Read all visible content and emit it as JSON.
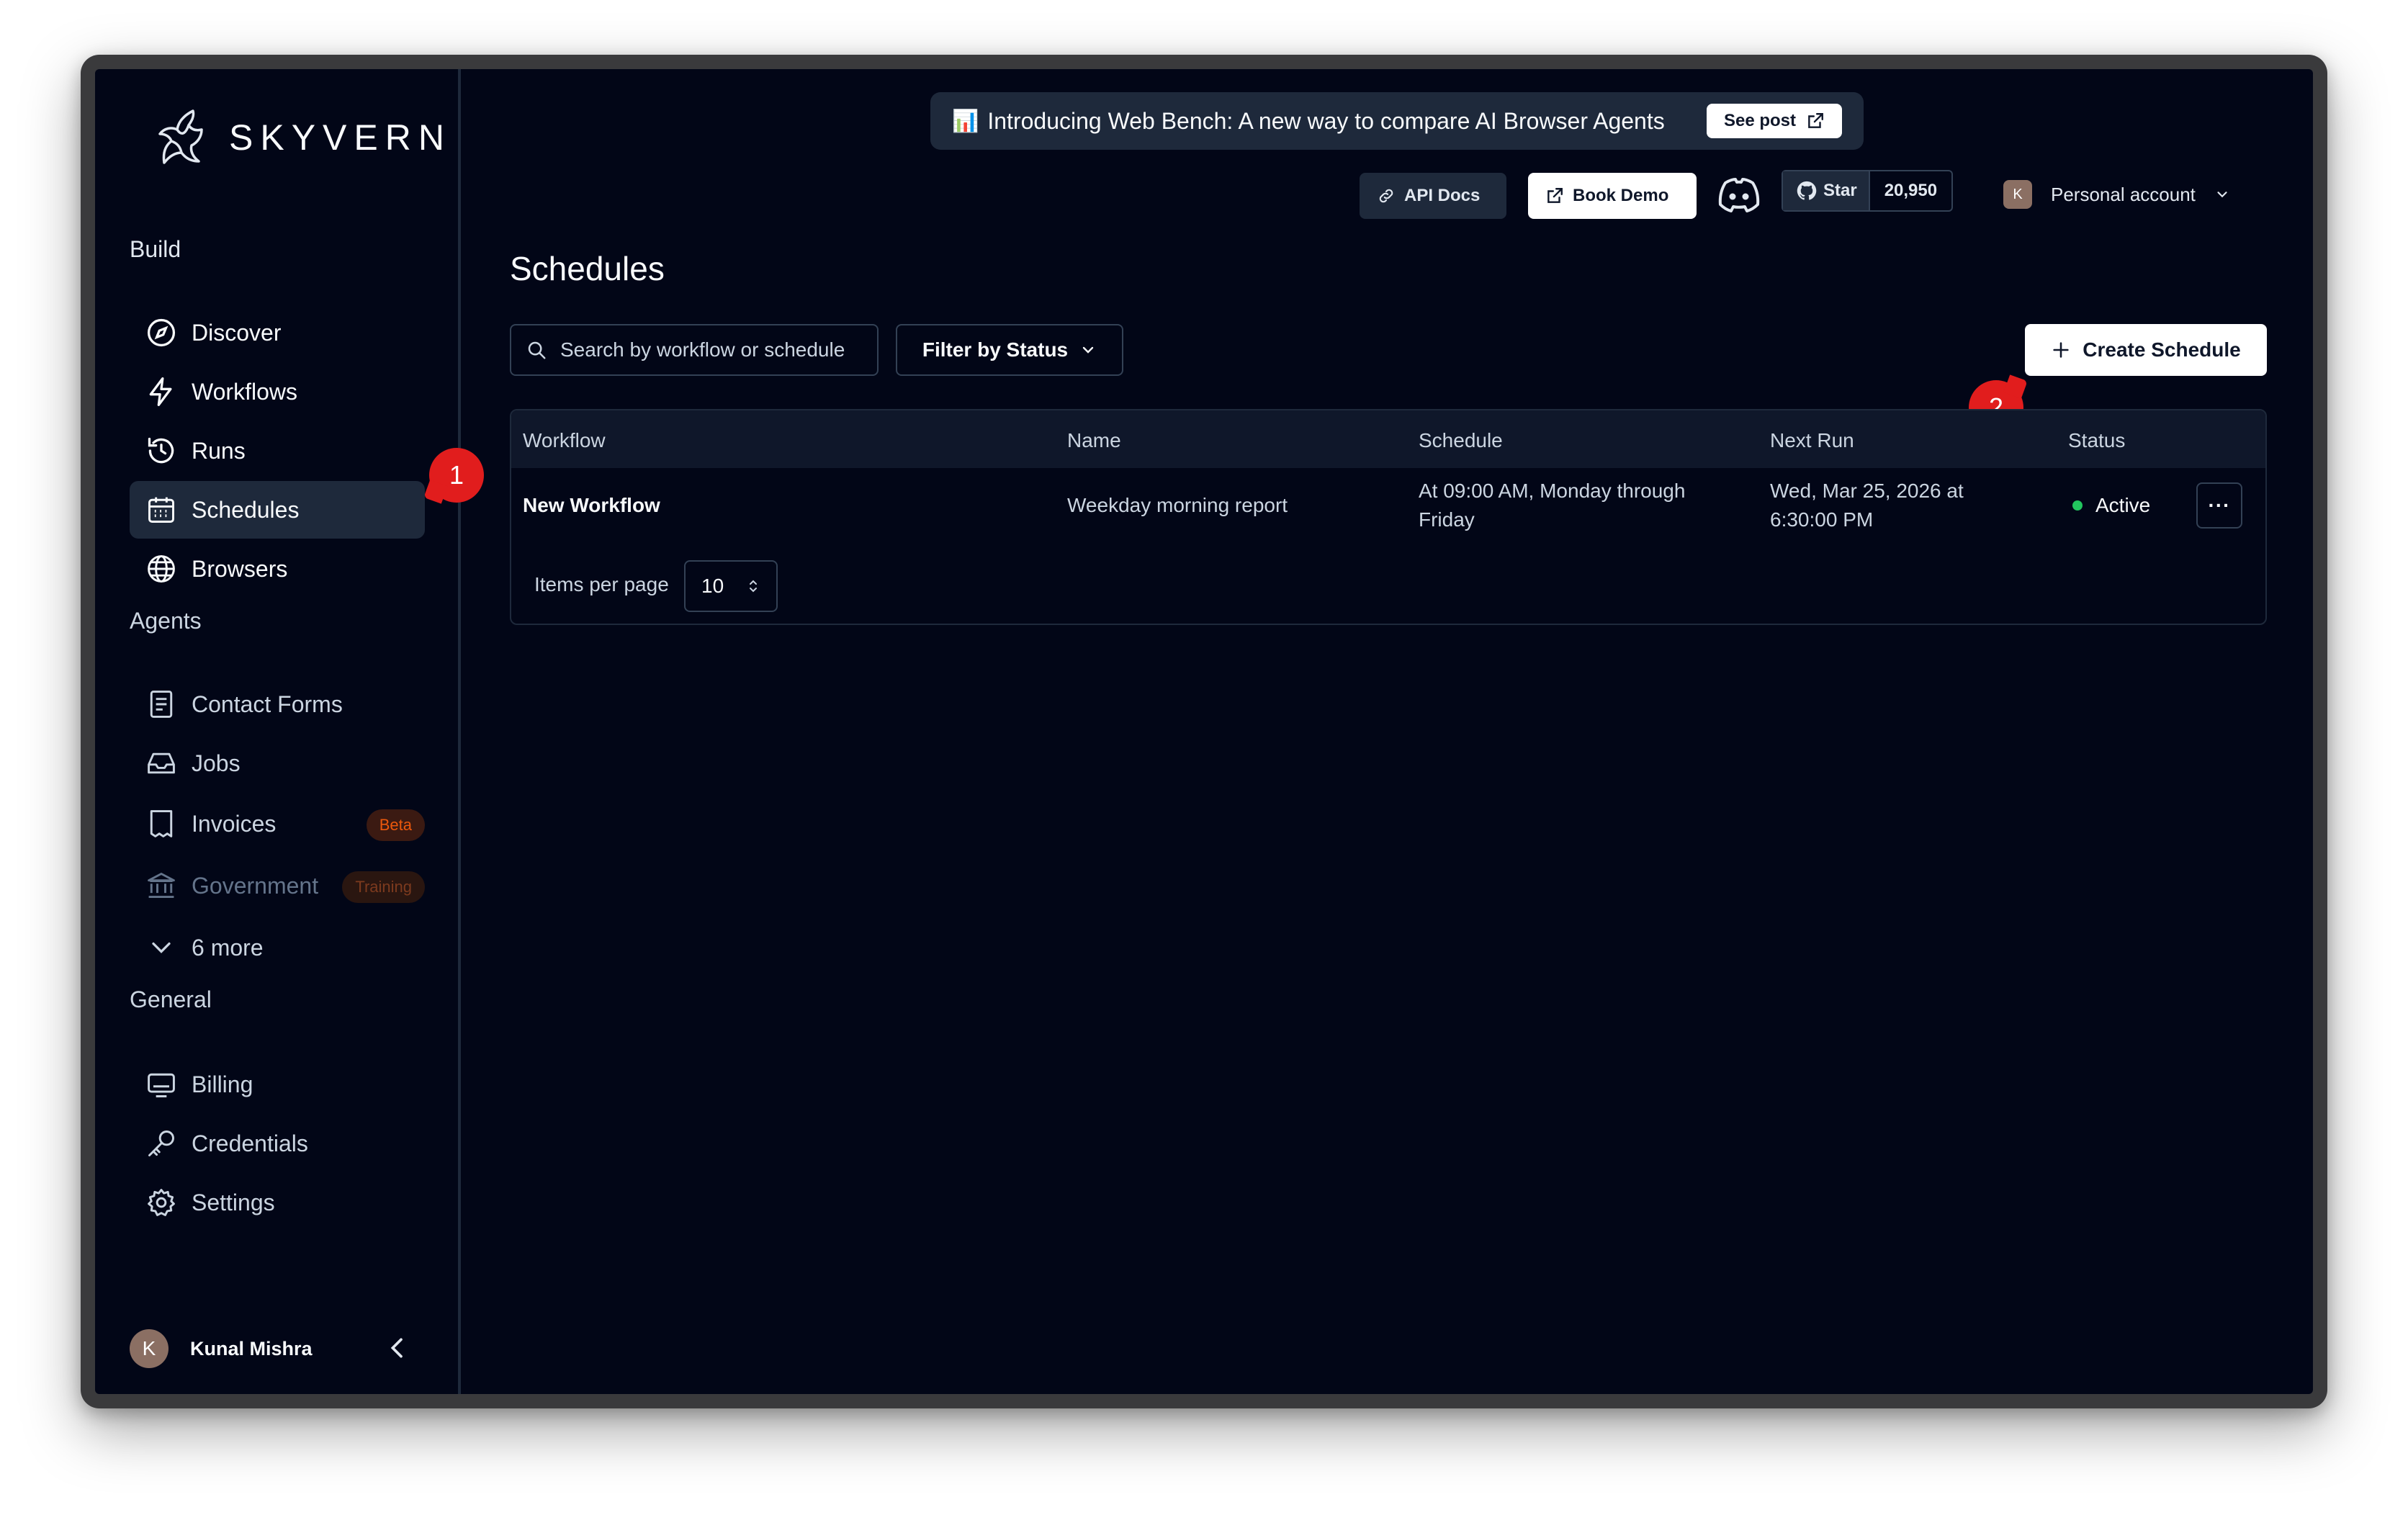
{
  "app": {
    "logo_text": "SKYVERN"
  },
  "sidebar": {
    "sections": {
      "build": "Build",
      "agents": "Agents",
      "general": "General"
    },
    "build_items": [
      {
        "label": "Discover",
        "icon": "compass-icon"
      },
      {
        "label": "Workflows",
        "icon": "lightning-icon"
      },
      {
        "label": "Runs",
        "icon": "history-icon"
      },
      {
        "label": "Schedules",
        "icon": "calendar-icon",
        "active": true
      },
      {
        "label": "Browsers",
        "icon": "globe-icon"
      }
    ],
    "agent_items": [
      {
        "label": "Contact Forms",
        "icon": "form-icon"
      },
      {
        "label": "Jobs",
        "icon": "inbox-icon"
      },
      {
        "label": "Invoices",
        "icon": "receipt-icon",
        "badge": "Beta"
      },
      {
        "label": "Government",
        "icon": "landmark-icon",
        "badge": "Training",
        "disabled": true
      },
      {
        "label": "6 more",
        "icon": "chevron-down-icon"
      }
    ],
    "general_items": [
      {
        "label": "Billing",
        "icon": "billing-icon"
      },
      {
        "label": "Credentials",
        "icon": "key-icon"
      },
      {
        "label": "Settings",
        "icon": "gear-icon"
      }
    ],
    "user": {
      "initial": "K",
      "name": "Kunal Mishra"
    }
  },
  "markers": {
    "one": "1",
    "two": "2"
  },
  "banner": {
    "emoji": "📊",
    "text": "Introducing Web Bench: A new way to compare AI Browser Agents",
    "cta": "See post"
  },
  "topbar": {
    "api_docs": "API Docs",
    "book_demo": "Book Demo",
    "github_star": "Star",
    "github_count": "20,950",
    "account_initial": "K",
    "account_label": "Personal account"
  },
  "page": {
    "title": "Schedules",
    "search_placeholder": "Search by workflow or schedule",
    "filter_label": "Filter by Status",
    "create_label": "Create Schedule"
  },
  "table": {
    "columns": [
      "Workflow",
      "Name",
      "Schedule",
      "Next Run",
      "Status"
    ],
    "rows": [
      {
        "workflow": "New Workflow",
        "name": "Weekday morning report",
        "schedule_line1": "At 09:00 AM, Monday through",
        "schedule_line2": "Friday",
        "next_run_line1": "Wed, Mar 25, 2026 at",
        "next_run_line2": "6:30:00 PM",
        "status": "Active",
        "status_color": "#22c55e",
        "actions": "···"
      }
    ],
    "items_per_page_label": "Items per page",
    "items_per_page_value": "10"
  }
}
